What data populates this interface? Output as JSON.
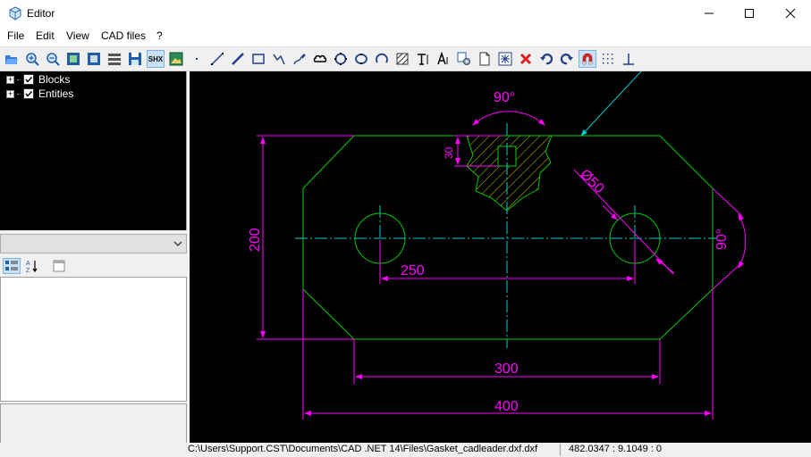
{
  "window": {
    "title": "Editor",
    "controls": [
      "minimize-icon",
      "maximize-icon",
      "close-icon"
    ]
  },
  "menu": {
    "items": [
      "File",
      "Edit",
      "View",
      "CAD files",
      "?"
    ]
  },
  "toolbar": {
    "shx_label": "SHX",
    "buttons": [
      "open-icon",
      "zoom-in-icon",
      "zoom-out-icon",
      "zoom-extents-icon",
      "zoom-window-icon",
      "layers-icon",
      "save-icon",
      "shx-fonts",
      "image-icon",
      "point-icon",
      "line-icon",
      "polyline-icon",
      "rectangle-icon",
      "spline-icon",
      "sketch-icon",
      "cloud-icon",
      "circle-icon",
      "ellipse-icon",
      "arc-icon",
      "hatch-icon",
      "text-icon",
      "mtext-icon",
      "settings-icon",
      "page-icon",
      "fit-icon",
      "delete-icon",
      "undo-icon",
      "redo-icon",
      "snap-magnet-icon",
      "grid-icon",
      "ortho-icon"
    ],
    "active": [
      "shx-fonts",
      "snap-magnet-icon"
    ]
  },
  "tree": {
    "items": [
      {
        "label": "Blocks",
        "checked": true,
        "expander": "+"
      },
      {
        "label": "Entities",
        "checked": true,
        "expander": "+"
      }
    ]
  },
  "properties": {
    "combo_value": "",
    "sort_icons": [
      "categorized-icon",
      "alphabetical-icon",
      "property-pages-icon"
    ]
  },
  "drawing": {
    "dimensions": {
      "angle_top": "90°",
      "depth": "30",
      "diameter": "Ø50",
      "angle_right": "90°",
      "height": "200",
      "hole_spacing": "250",
      "bottom_width": "300",
      "total_width": "400"
    },
    "colors": {
      "outline": "#00cc00",
      "dimension": "#ff00ff",
      "centerline": "#00cccc",
      "hatch": "#cccc00",
      "background": "#000000"
    }
  },
  "status": {
    "path": "C:\\Users\\Support.CST\\Documents\\CAD .NET 14\\Files\\Gasket_cadleader.dxf.dxf",
    "coords": "482.0347 : 9.1049 : 0"
  }
}
